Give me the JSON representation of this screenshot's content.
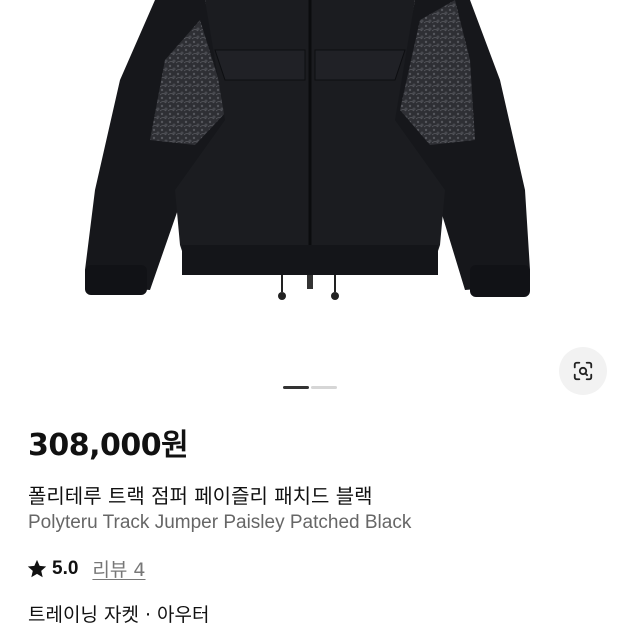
{
  "product": {
    "price": "308,000원",
    "name_ko": "폴리테루 트랙 점퍼 페이즐리 패치드 블랙",
    "name_en": "Polyteru Track Jumper Paisley Patched Black",
    "rating": "5.0",
    "review_label": "리뷰 4",
    "category": "트레이닝 자켓 · 아우터"
  },
  "gallery": {
    "image_alt": "black track jumper with paisley patched sleeves",
    "dot_count": 2,
    "active_index": 0
  },
  "icons": {
    "lens": "visual-search-icon",
    "star": "star-icon"
  },
  "colors": {
    "star": "#111111",
    "jacket": "#16171b",
    "paisley": "#3a3b40"
  }
}
